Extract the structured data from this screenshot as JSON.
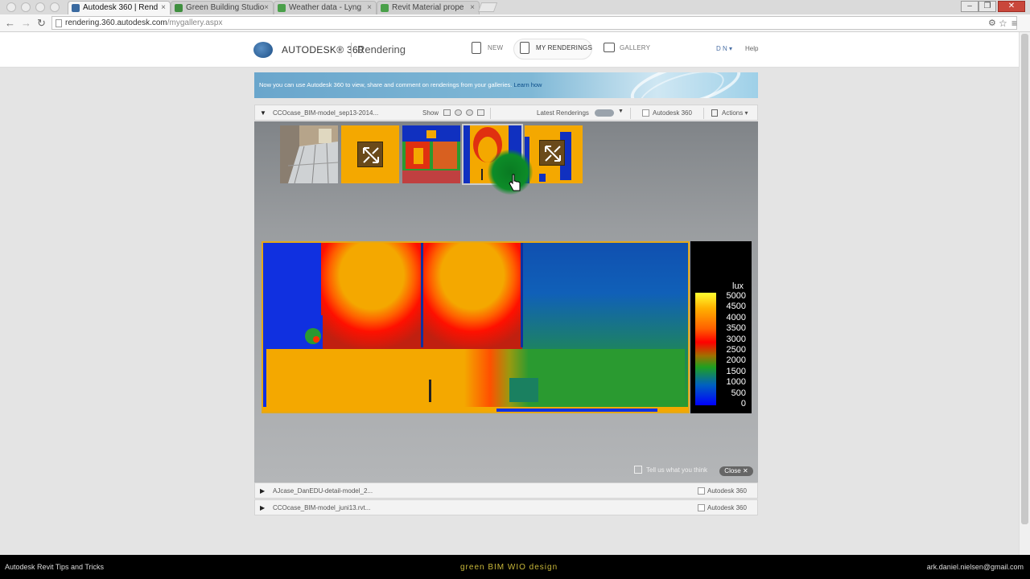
{
  "browser": {
    "tabs": [
      {
        "label": "Autodesk 360 | Rend",
        "active": true,
        "fav_color": "#3a6aa0"
      },
      {
        "label": "Green Building Studio",
        "active": false,
        "fav_color": "#3f8f3f"
      },
      {
        "label": "Weather data - Lyng",
        "active": false,
        "fav_color": "#4aa04a"
      },
      {
        "label": "Revit Material prope",
        "active": false,
        "fav_color": "#4aa04a"
      }
    ],
    "tab_close": "×",
    "window_controls": [
      "–",
      "❐",
      "✕"
    ],
    "url_host": "rendering.360.autodesk.com",
    "url_path": "/mygallery.aspx"
  },
  "header": {
    "brand": "AUTODESK® 360",
    "product": "Rendering",
    "nav": [
      "NEW",
      "MY RENDERINGS",
      "GALLERY"
    ],
    "user": "D N ▾",
    "help": "Help"
  },
  "banner": {
    "text": "Now you can use Autodesk 360 to view, share and comment on renderings from your galleries.",
    "link": "Learn how"
  },
  "project": {
    "title": "CCOcase_BIM-model_sep13-2014...",
    "show_label": "Show",
    "sort_label": "Latest Renderings",
    "autodesk360_label": "Autodesk 360",
    "actions_label": "Actions ▾"
  },
  "legend": {
    "unit": "lux",
    "labels": [
      "5000",
      "4500",
      "4000",
      "3500",
      "3000",
      "2500",
      "2000",
      "1500",
      "1000",
      "500",
      "0"
    ]
  },
  "feedback": {
    "text": "Tell us what you think",
    "close": "Close ✕"
  },
  "projects_collapsed": [
    {
      "title": "AJcase_DanEDU-detail-model_2...",
      "autodesk360_label": "Autodesk 360"
    },
    {
      "title": "CCOcase_BIM-model_juni13.rvt...",
      "autodesk360_label": "Autodesk 360"
    }
  ],
  "footer": {
    "left": "Autodesk Revit Tips and Tricks",
    "mid": "green BIM WIO design",
    "right": "ark.daniel.nielsen@gmail.com"
  }
}
